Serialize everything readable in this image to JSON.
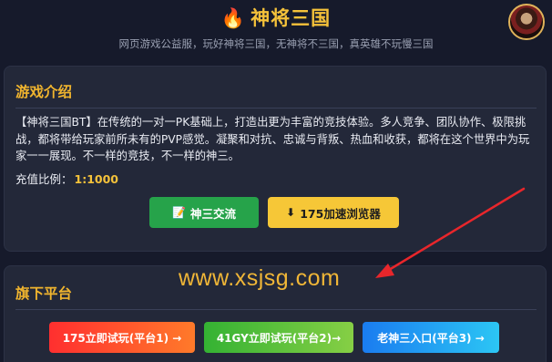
{
  "header": {
    "title": "神将三国",
    "subtitle": "网页游戏公益服，玩好神将三国，无神将不三国，真英雄不玩慢三国"
  },
  "intro": {
    "title": "游戏介绍",
    "description": "【神将三国BT】在传统的一对一PK基础上，打造出更为丰富的竞技体验。多人竞争、团队协作、极限挑战，都将带给玩家前所未有的PVP感觉。凝聚和对抗、忠诚与背叛、热血和收获，都将在这个世界中为玩家一一展现。不一样的竞技，不一样的神三。",
    "ratio_label": "充值比例：",
    "ratio_value": "1:1000",
    "buttons": {
      "community": "神三交流",
      "browser": "175加速浏览器"
    }
  },
  "platforms": {
    "title": "旗下平台",
    "items": [
      {
        "label": "175立即试玩(平台1) →"
      },
      {
        "label": "41GY立即试玩(平台2)→"
      },
      {
        "label": "老神三入口(平台3) →"
      }
    ]
  },
  "watermark": "www.xsjsg.com",
  "icons": {
    "title": "fire-icon",
    "community": "document-icon",
    "browser": "download-arrow-icon"
  },
  "colors": {
    "accent": "#f5c23a",
    "background": "#161a2b",
    "card": "#232839",
    "green": "#26a34a",
    "yellow": "#f6c737",
    "arrow": "#e8262b"
  }
}
